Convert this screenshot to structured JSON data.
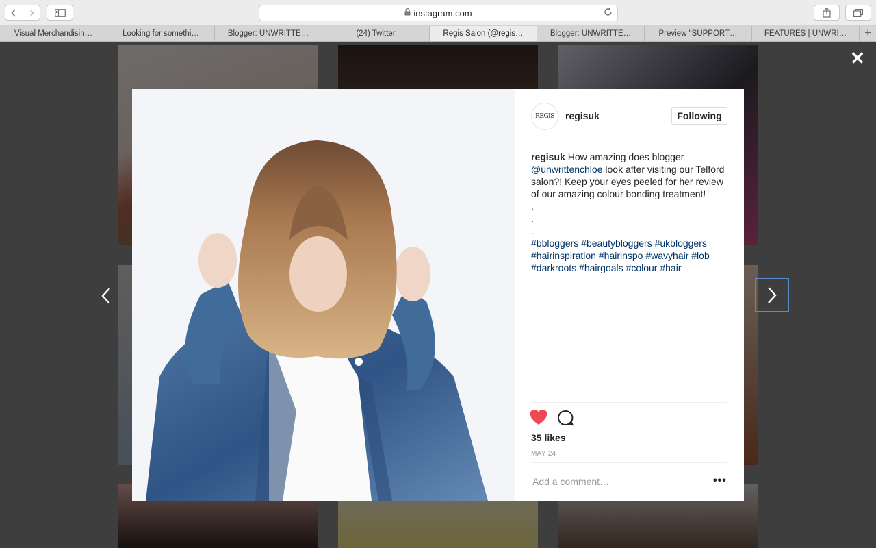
{
  "browser": {
    "url": "instagram.com",
    "tabs": [
      {
        "label": "Visual Merchandisin…",
        "active": false
      },
      {
        "label": "Looking for somethi…",
        "active": false
      },
      {
        "label": "Blogger: UNWRITTE…",
        "active": false
      },
      {
        "label": "(24) Twitter",
        "active": false
      },
      {
        "label": "Regis Salon (@regis…",
        "active": true
      },
      {
        "label": "Blogger: UNWRITTE…",
        "active": false
      },
      {
        "label": "Preview \"SUPPORT…",
        "active": false
      },
      {
        "label": "FEATURES | UNWRI…",
        "active": false
      }
    ],
    "new_tab_label": "+"
  },
  "modal": {
    "close_label": "✕",
    "avatar_text": "REGIS",
    "username": "regisuk",
    "follow_label": "Following",
    "caption": {
      "username": "regisuk",
      "text_before": "How amazing does blogger",
      "mention": "@unwrittenchloe",
      "text_after": "look after visiting our Telford salon?! Keep your eyes peeled for her review of our amazing colour bonding treatment!",
      "dots": [
        ".",
        ".",
        "."
      ],
      "hashtags": [
        "#bbloggers",
        "#beautybloggers",
        "#ukbloggers",
        "#hairinspiration",
        "#hairinspo",
        "#wavyhair",
        "#lob",
        "#darkroots",
        "#hairgoals",
        "#colour",
        "#hair"
      ]
    },
    "likes": "35 likes",
    "date": "MAY 24",
    "comment_placeholder": "Add a comment…",
    "more_label": "•••",
    "liked": true,
    "heart_color": "#ed4956"
  }
}
